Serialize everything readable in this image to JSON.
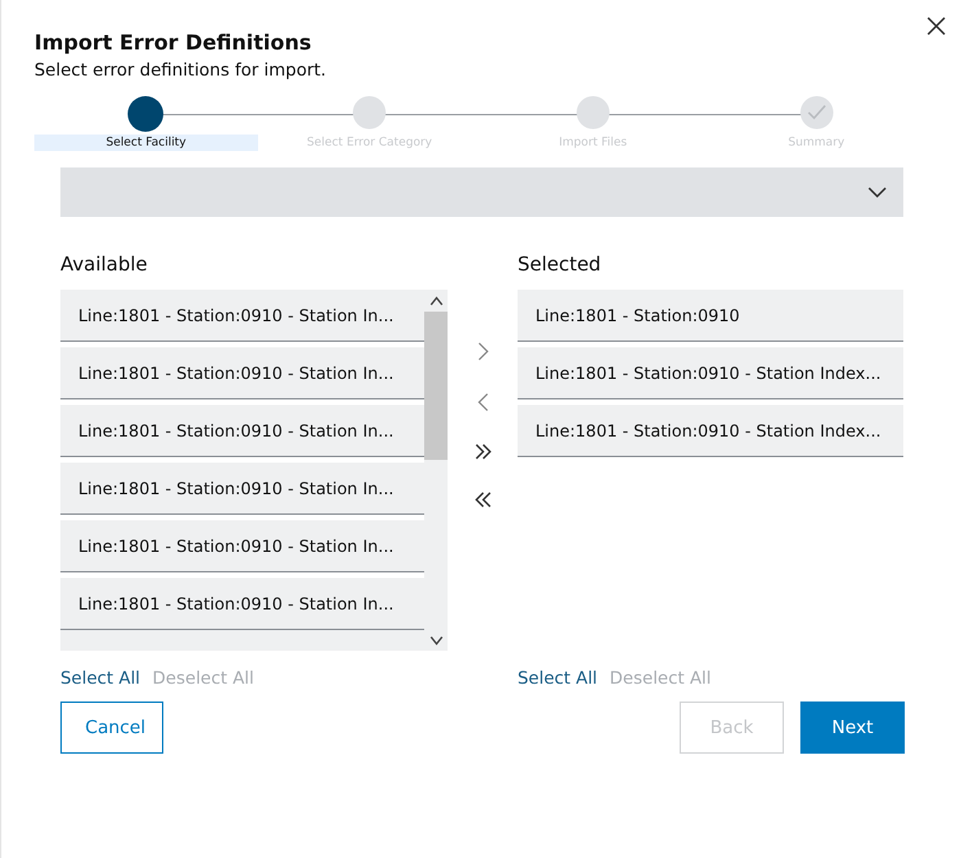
{
  "dialog": {
    "title": "Import Error Definitions",
    "subtitle": "Select error definitions for import."
  },
  "steps": [
    {
      "label": "Select Facility",
      "selected": true,
      "kind": "dot"
    },
    {
      "label": "Select Error Category",
      "selected": false,
      "kind": "dot"
    },
    {
      "label": "Import Files",
      "selected": false,
      "kind": "dot"
    },
    {
      "label": "Summary",
      "selected": false,
      "kind": "check"
    }
  ],
  "available": {
    "heading": "Available",
    "items": [
      "Line:1801 - Station:0910 - Station In...",
      "Line:1801 - Station:0910 - Station In...",
      "Line:1801 - Station:0910 - Station In...",
      "Line:1801 - Station:0910 - Station In...",
      "Line:1801 - Station:0910 - Station In...",
      "Line:1801 - Station:0910 - Station In..."
    ],
    "links": [
      {
        "label": "Select All",
        "disabled": false
      },
      {
        "label": "Deselect All",
        "disabled": true
      }
    ]
  },
  "selected_list": {
    "heading": "Selected",
    "items": [
      "Line:1801 - Station:0910",
      "Line:1801 - Station:0910 - Station Index...",
      "Line:1801 - Station:0910 - Station Index..."
    ],
    "links": [
      {
        "label": "Select All",
        "disabled": false
      },
      {
        "label": "Deselect All",
        "disabled": true
      }
    ]
  },
  "buttons": [
    {
      "label": "Cancel",
      "kind": "outline",
      "disabled": false
    },
    {
      "label": "Back",
      "kind": "outline",
      "disabled": true
    },
    {
      "label": "Next",
      "kind": "primary",
      "disabled": false
    }
  ]
}
